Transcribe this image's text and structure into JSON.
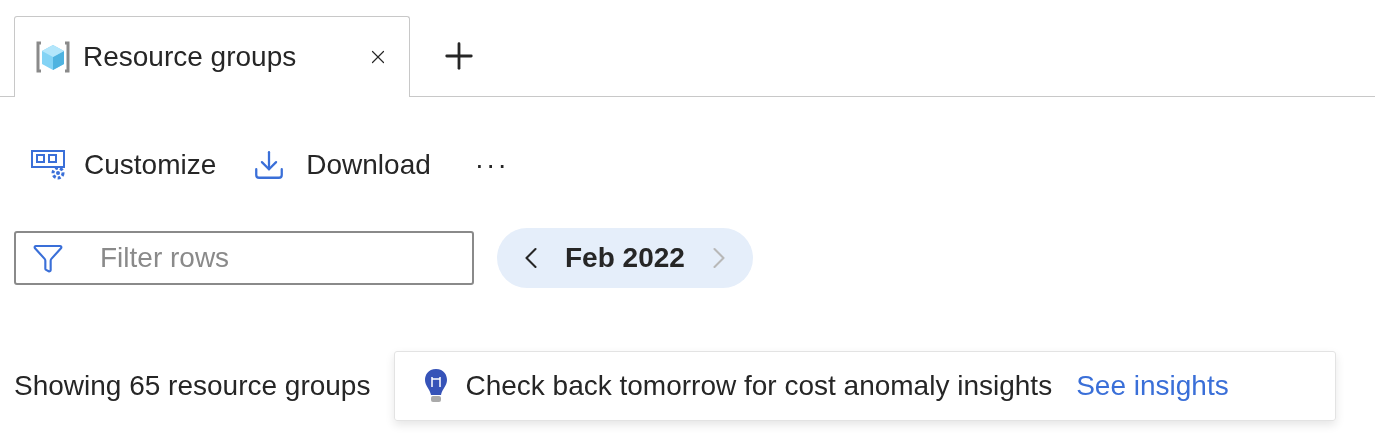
{
  "tabs": [
    {
      "label": "Resource groups",
      "selected": true
    }
  ],
  "toolbar": [
    {
      "label": "Customize",
      "kind": "customize"
    },
    {
      "label": "Download",
      "kind": "download"
    },
    {
      "label": "···",
      "kind": "more"
    }
  ],
  "filter": {
    "placeholder": "Filter rows"
  },
  "period": {
    "label": "Feb 2022",
    "next_disabled": true
  },
  "summary": "Showing 65 resource groups",
  "insight": {
    "message": "Check back tomorrow for cost anomaly insights",
    "link": "See insights"
  }
}
